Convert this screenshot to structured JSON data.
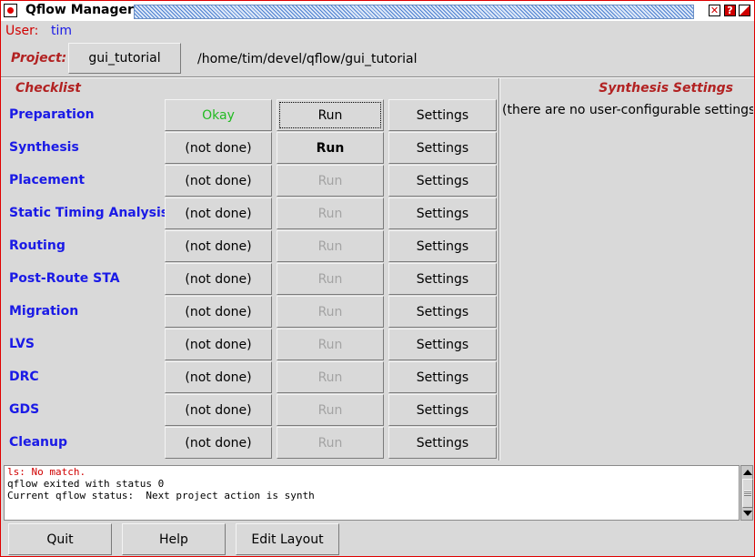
{
  "window": {
    "title": "Qflow Manager"
  },
  "user": {
    "label": "User:",
    "name": "tim"
  },
  "project": {
    "label": "Project:",
    "button_label": "gui_tutorial",
    "path": "/home/tim/devel/qflow/gui_tutorial"
  },
  "checklist": {
    "heading": "Checklist",
    "steps": [
      {
        "name": "Preparation",
        "status": "Okay",
        "run": "Run",
        "settings": "Settings"
      },
      {
        "name": "Synthesis",
        "status": "(not done)",
        "run": "Run",
        "settings": "Settings"
      },
      {
        "name": "Placement",
        "status": "(not done)",
        "run": "Run",
        "settings": "Settings"
      },
      {
        "name": "Static Timing Analysis",
        "status": "(not done)",
        "run": "Run",
        "settings": "Settings"
      },
      {
        "name": "Routing",
        "status": "(not done)",
        "run": "Run",
        "settings": "Settings"
      },
      {
        "name": "Post-Route STA",
        "status": "(not done)",
        "run": "Run",
        "settings": "Settings"
      },
      {
        "name": "Migration",
        "status": "(not done)",
        "run": "Run",
        "settings": "Settings"
      },
      {
        "name": "LVS",
        "status": "(not done)",
        "run": "Run",
        "settings": "Settings"
      },
      {
        "name": "DRC",
        "status": "(not done)",
        "run": "Run",
        "settings": "Settings"
      },
      {
        "name": "GDS",
        "status": "(not done)",
        "run": "Run",
        "settings": "Settings"
      },
      {
        "name": "Cleanup",
        "status": "(not done)",
        "run": "Run",
        "settings": "Settings"
      }
    ]
  },
  "synthesis_settings": {
    "heading": "Synthesis Settings",
    "text": "(there are no user-configurable settings"
  },
  "console": {
    "lines": [
      {
        "text": "ls: No match.",
        "kind": "error"
      },
      {
        "text": "qflow exited with status 0",
        "kind": "normal"
      },
      {
        "text": "Current qflow status:  Next project action is synth",
        "kind": "normal"
      }
    ]
  },
  "buttons": {
    "quit": "Quit",
    "help": "Help",
    "edit_layout": "Edit Layout"
  },
  "colors": {
    "label_red": "#b22222",
    "step_blue": "#1a1ae6",
    "okay_green": "#22bb22",
    "disabled_gray": "#a3a3a3"
  }
}
